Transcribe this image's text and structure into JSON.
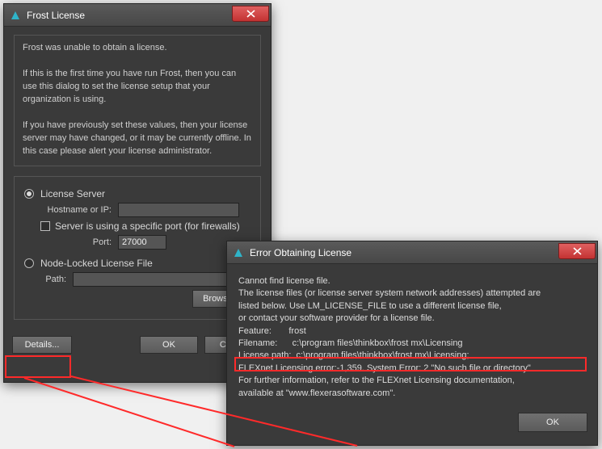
{
  "frost": {
    "window_title": "Frost License",
    "intro": "Frost was unable to obtain a license.",
    "first_time": "If this is the first time you have run Frost, then you can use this dialog to set the license setup that your organization is using.",
    "previously": "If you have previously set these values, then your license server may have changed, or it may be currently offline.  In this case please alert your license administrator.",
    "radio_server": "License Server",
    "hostname_label": "Hostname or IP:",
    "hostname_value": "",
    "server_port_cb": "Server is using a specific port (for firewalls)",
    "port_label": "Port:",
    "port_value": "27000",
    "radio_node": "Node-Locked License File",
    "path_label": "Path:",
    "path_value": "",
    "browse": "Browse...",
    "details": "Details...",
    "ok": "OK",
    "cancel": "Cancel"
  },
  "error": {
    "window_title": "Error Obtaining License",
    "l1": "Cannot find license file.",
    "l2": " The license files (or license server system network addresses) attempted are",
    "l3": "listed below.  Use LM_LICENSE_FILE to use a different license file,",
    "l4": " or contact your software provider for a license file.",
    "feature": "Feature:       frost",
    "filename": "Filename:      c:\\program files\\thinkbox\\frost mx\\Licensing",
    "licpath": "License path:  c:\\program files\\thinkbox\\frost mx\\Licensing;",
    "flexnet": "FLEXnet Licensing error:-1,359.  System Error: 2 \"No such file or directory\"",
    "more1": "For further information, refer to the FLEXnet Licensing documentation,",
    "more2": "available at \"www.flexerasoftware.com\".",
    "ok": "OK"
  }
}
